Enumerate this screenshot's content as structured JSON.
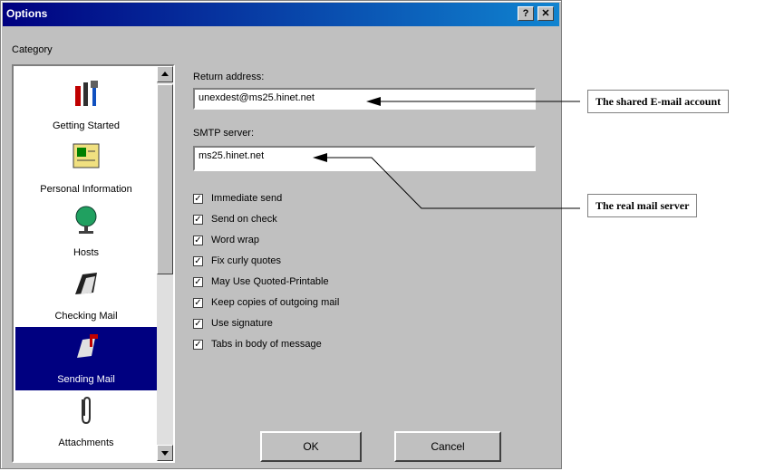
{
  "window": {
    "title": "Options",
    "help_glyph": "?",
    "close_glyph": "✕"
  },
  "category": {
    "label": "Category",
    "items": [
      {
        "label": "Getting Started",
        "icon": "tools-icon"
      },
      {
        "label": "Personal Information",
        "icon": "id-card-icon"
      },
      {
        "label": "Hosts",
        "icon": "globe-icon"
      },
      {
        "label": "Checking Mail",
        "icon": "mailbox-icon"
      },
      {
        "label": "Sending Mail",
        "icon": "mailbox-flag-icon",
        "selected": true
      },
      {
        "label": "Attachments",
        "icon": "paperclip-icon"
      }
    ]
  },
  "form": {
    "return_address": {
      "label": "Return address:",
      "value": "unexdest@ms25.hinet.net"
    },
    "smtp_server": {
      "label": "SMTP server:",
      "value": "ms25.hinet.net"
    }
  },
  "options": [
    {
      "label": "Immediate send",
      "checked": true
    },
    {
      "label": "Send on check",
      "checked": true
    },
    {
      "label": "Word wrap",
      "checked": true
    },
    {
      "label": "Fix curly quotes",
      "checked": true
    },
    {
      "label": "May Use Quoted-Printable",
      "checked": true
    },
    {
      "label": "Keep copies of outgoing mail",
      "checked": true
    },
    {
      "label": "Use signature",
      "checked": true
    },
    {
      "label": "Tabs in body of message",
      "checked": true
    }
  ],
  "buttons": {
    "ok": "OK",
    "cancel": "Cancel"
  },
  "annotations": {
    "shared_account": "The shared E-mail account",
    "real_server": "The real mail server"
  }
}
